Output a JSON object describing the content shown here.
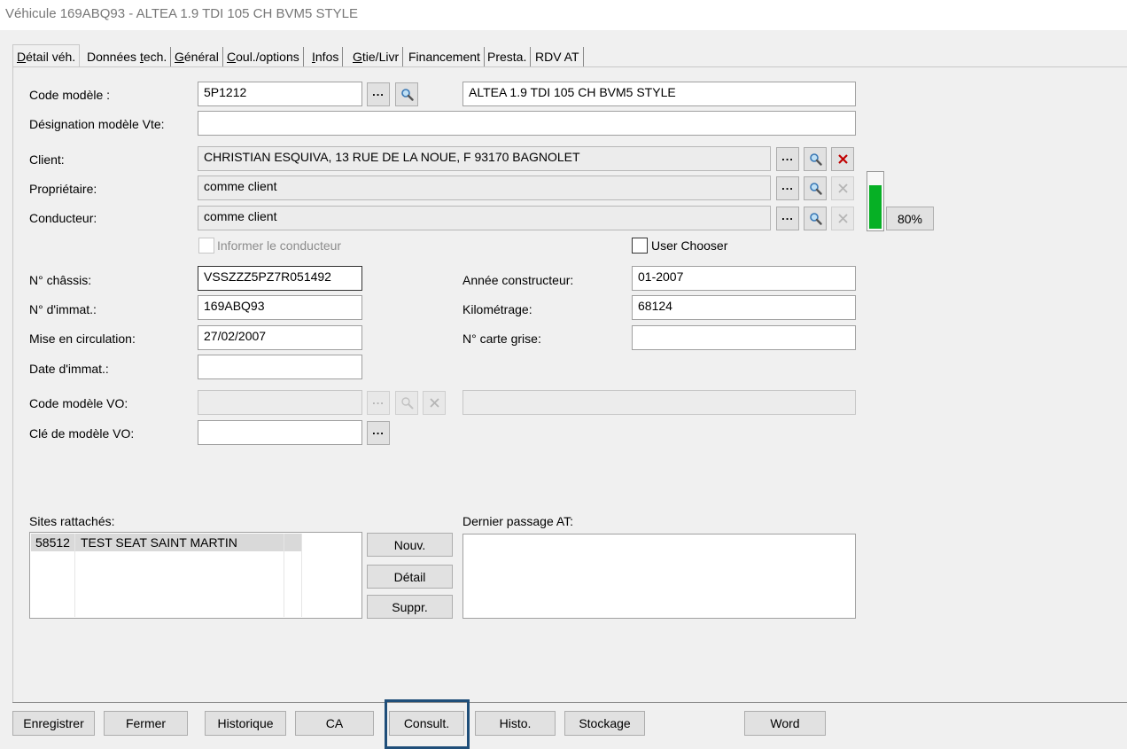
{
  "window": {
    "title": "Véhicule 169ABQ93 - ALTEA 1.9 TDI 105 CH BVM5 STYLE"
  },
  "tabs": [
    {
      "label": "Détail véh.",
      "active": true
    },
    {
      "label": "Données tech."
    },
    {
      "label": "Général"
    },
    {
      "label": "Coul./options"
    },
    {
      "label": "Infos"
    },
    {
      "label": "Gtie/Livr"
    },
    {
      "label": "Financement"
    },
    {
      "label": "Presta."
    },
    {
      "label": "RDV AT"
    }
  ],
  "form": {
    "code_modele": {
      "label": "Code modèle :",
      "value": "5P1212",
      "description": "ALTEA 1.9 TDI 105 CH BVM5 STYLE"
    },
    "designation_vte": {
      "label": "Désignation modèle Vte:",
      "value": ""
    },
    "client": {
      "label": "Client:",
      "value": "CHRISTIAN ESQUIVA, 13 RUE DE LA NOUE, F 93170 BAGNOLET"
    },
    "proprietaire": {
      "label": "Propriétaire:",
      "value": "comme client"
    },
    "conducteur": {
      "label": "Conducteur:",
      "value": "comme client"
    },
    "informer_conducteur": {
      "label": "Informer le conducteur",
      "checked": false,
      "enabled": false
    },
    "user_chooser": {
      "label": "User Chooser",
      "checked": false
    },
    "completion": {
      "value": 80,
      "label": "80%",
      "color": "#06b025"
    },
    "chassis": {
      "label": "N° châssis:",
      "value": "VSSZZZ5PZ7R051492"
    },
    "immat": {
      "label": "N° d'immat.:",
      "value": "169ABQ93"
    },
    "mise_circulation": {
      "label": "Mise en circulation:",
      "value": "27/02/2007"
    },
    "date_immat": {
      "label": "Date d'immat.:",
      "value": ""
    },
    "annee_constructeur": {
      "label": "Année constructeur:",
      "value": "01-2007"
    },
    "kilometrage": {
      "label": "Kilométrage:",
      "value": "68124"
    },
    "carte_grise": {
      "label": "N° carte grise:",
      "value": ""
    },
    "code_modele_vo": {
      "label": "Code modèle VO:",
      "value": "",
      "description": ""
    },
    "cle_modele_vo": {
      "label": "Clé de modèle VO:",
      "value": ""
    }
  },
  "sites": {
    "label": "Sites rattachés:",
    "rows": [
      {
        "code": "58512",
        "name": "TEST SEAT SAINT MARTIN"
      }
    ],
    "buttons": {
      "new": "Nouv.",
      "detail": "Détail",
      "delete": "Suppr."
    }
  },
  "dernier_passage": {
    "label": "Dernier passage AT:",
    "value": ""
  },
  "icons": {
    "browse": "ellipsis-icon",
    "search": "magnifier-icon",
    "clear": "x-icon"
  },
  "footer": {
    "buttons": [
      "Enregistrer",
      "Fermer",
      "Historique",
      "CA",
      "Consult.",
      "Histo.",
      "Stockage",
      "Word"
    ]
  },
  "colors": {
    "highlight": "#1f4e79",
    "clear_active": "#c00000"
  }
}
